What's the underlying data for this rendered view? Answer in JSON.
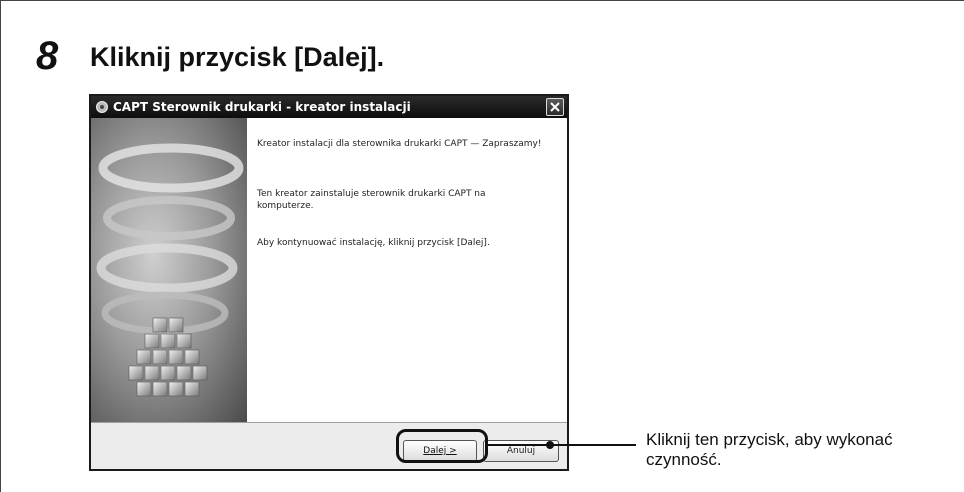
{
  "step": {
    "number": "8",
    "heading": "Kliknij przycisk [Dalej]."
  },
  "dialog": {
    "title": "CAPT Sterownik drukarki - kreator instalacji",
    "paragraphs": [
      "Kreator instalacji dla sterownika drukarki CAPT — Zapraszamy!",
      "Ten kreator zainstaluje sterownik drukarki CAPT na komputerze.",
      "Aby kontynuować instalację, kliknij przycisk [Dalej]."
    ],
    "next_button": "Dalej >",
    "cancel_button": "Anuluj"
  },
  "callout": {
    "text": "Kliknij ten przycisk, aby wykonać czynność."
  }
}
